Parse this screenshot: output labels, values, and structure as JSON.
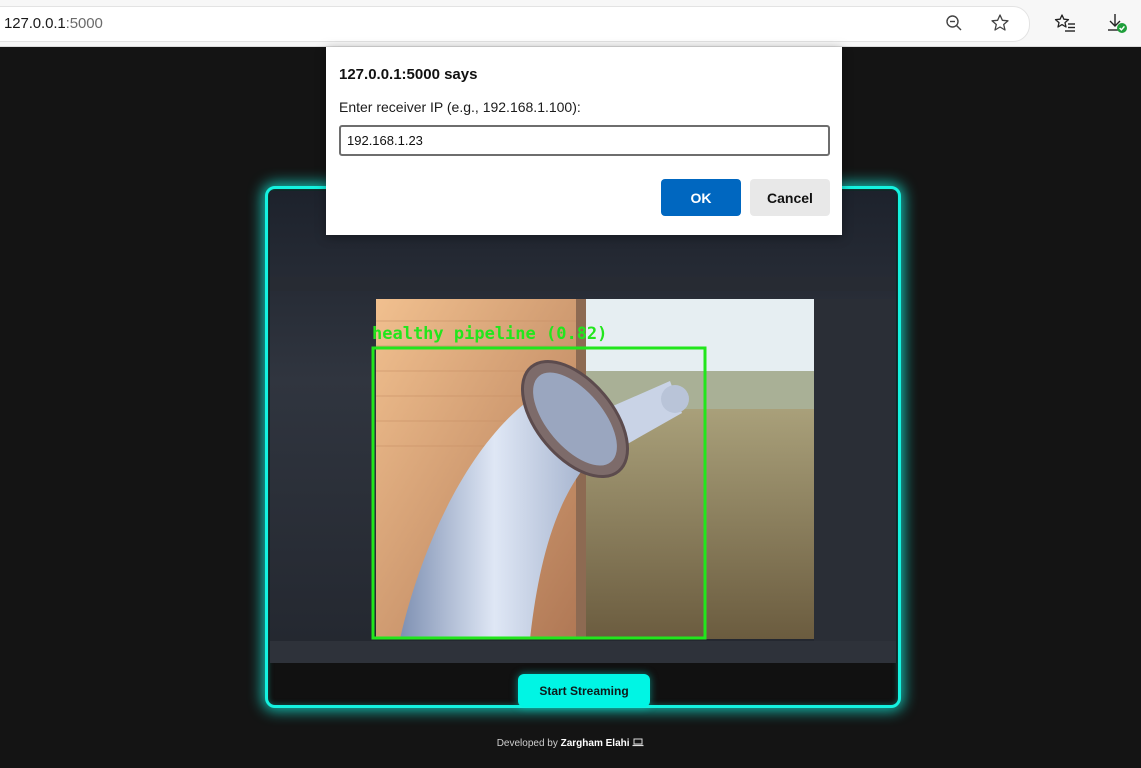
{
  "browser": {
    "url_host": "127.0.0.1",
    "url_port": ":5000",
    "icons": [
      "zoom-out-icon",
      "favorite-star-icon",
      "favorites-list-icon",
      "downloads-icon"
    ]
  },
  "dialog": {
    "title": "127.0.0.1:5000 says",
    "message": "Enter receiver IP (e.g., 192.168.1.100):",
    "input_value": "192.168.1.23",
    "ok_label": "OK",
    "cancel_label": "Cancel"
  },
  "stream": {
    "detection_label": "healthy pipeline (0.82)",
    "detection_color": "#22e61c",
    "accent_color": "#14f2e0",
    "start_button_label": "Start Streaming"
  },
  "footer": {
    "prefix": "Developed by",
    "author": "Zargham Elahi",
    "icon": "laptop-icon"
  }
}
